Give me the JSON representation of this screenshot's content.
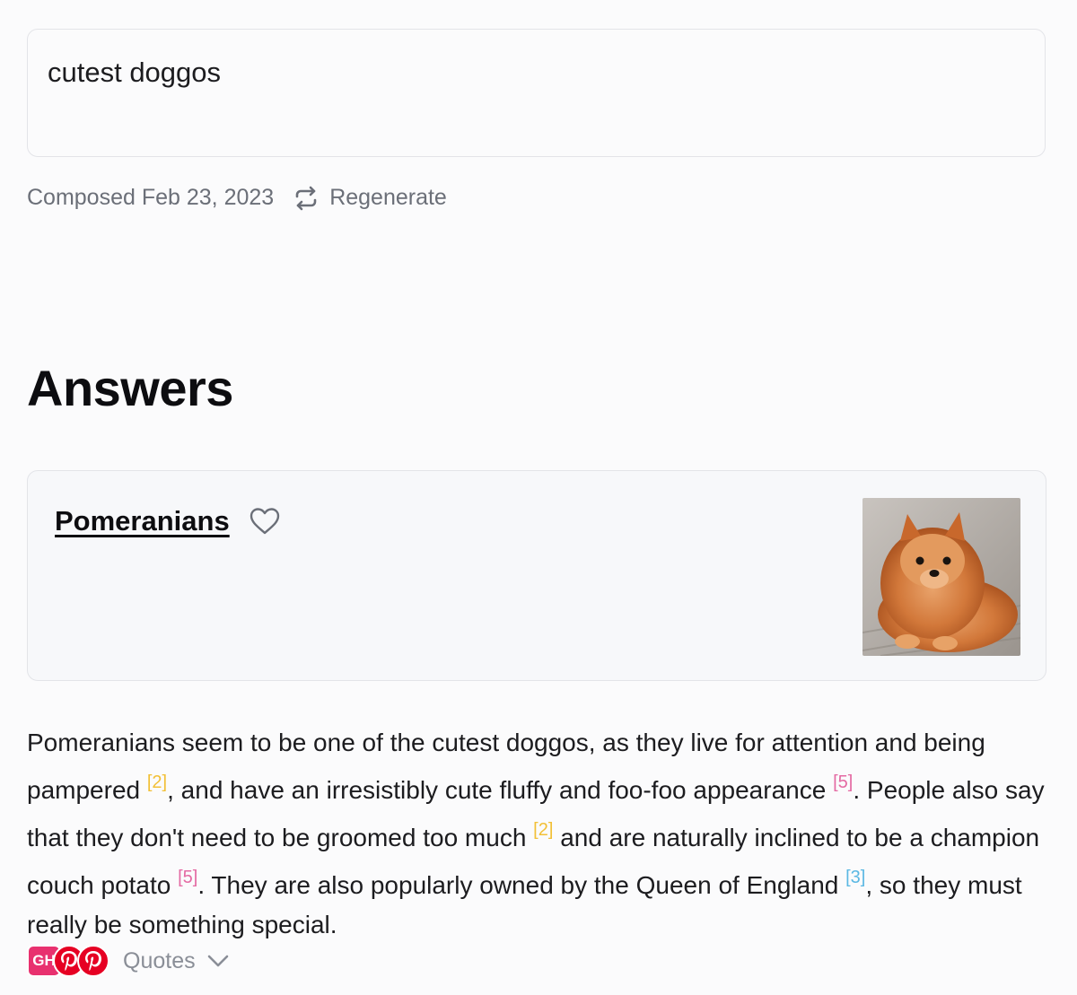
{
  "query": {
    "text": "cutest doggos"
  },
  "meta": {
    "composed": "Composed Feb 23, 2023",
    "regenerate_label": "Regenerate"
  },
  "answers_heading": "Answers",
  "card": {
    "title": "Pomeranians",
    "image_alt": "Pomeranian dog photo"
  },
  "answer": {
    "s1": "Pomeranians seem to be one of the cutest doggos, as they live for attention and being pampered ",
    "c1": "[2]",
    "s2": ", and have an irresistibly cute fluffy and foo-foo appearance ",
    "c2": "[5]",
    "s3": ". People also say that they don't need to be groomed too much ",
    "c3": "[2]",
    "s4": " and are naturally inclined to be a champion couch potato ",
    "c4": "[5]",
    "s5": ". They are also popularly owned by the Queen of England ",
    "c5": "[3]",
    "s6": ", so they must really be something special."
  },
  "footer": {
    "sources": [
      {
        "label": "GH"
      },
      {
        "label": "P"
      },
      {
        "label": "P"
      }
    ],
    "quotes_label": "Quotes"
  },
  "colors": {
    "cite_yellow": "#f2c037",
    "cite_pink": "#e46aa3",
    "cite_blue": "#5bb8e3",
    "pinterest": "#e60023"
  },
  "icons": [
    "regenerate-icon",
    "heart-icon",
    "chevron-down-icon",
    "pinterest-icon"
  ]
}
